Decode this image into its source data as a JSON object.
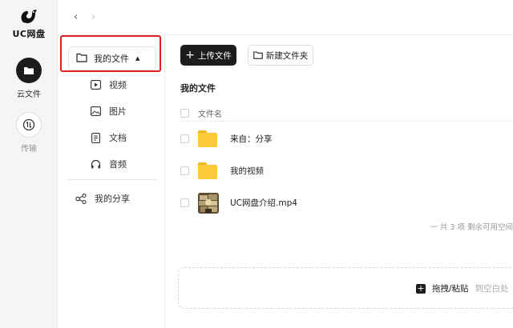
{
  "app": {
    "logo_text": "UC网盘"
  },
  "rail": {
    "items": [
      {
        "label": "云文件",
        "icon": "folder-icon"
      },
      {
        "label": "传输",
        "icon": "transfer-icon"
      }
    ]
  },
  "topbar": {
    "back": "‹",
    "forward": "›"
  },
  "nav": {
    "my_files": "我的文件",
    "items": [
      {
        "label": "视频",
        "icon": "video-icon"
      },
      {
        "label": "图片",
        "icon": "image-icon"
      },
      {
        "label": "文档",
        "icon": "document-icon"
      },
      {
        "label": "音频",
        "icon": "headphones-icon"
      }
    ],
    "share": "我的分享"
  },
  "toolbar": {
    "upload_label": "上传文件",
    "new_folder_label": "新建文件夹"
  },
  "list": {
    "title": "我的文件",
    "column_name": "文件名",
    "rows": [
      {
        "name": "来自：分享",
        "type": "folder"
      },
      {
        "name": "我的视频",
        "type": "folder"
      },
      {
        "name": "UC网盘介绍.mp4",
        "type": "video"
      }
    ],
    "footer": "一 共 3 项 剩余可用空间"
  },
  "dropzone": {
    "label": "拖拽/粘贴",
    "hint": "到空白处"
  },
  "colors": {
    "accent": "#1c1c1c",
    "highlight": "#e02020",
    "folder": "#ffca3a"
  }
}
